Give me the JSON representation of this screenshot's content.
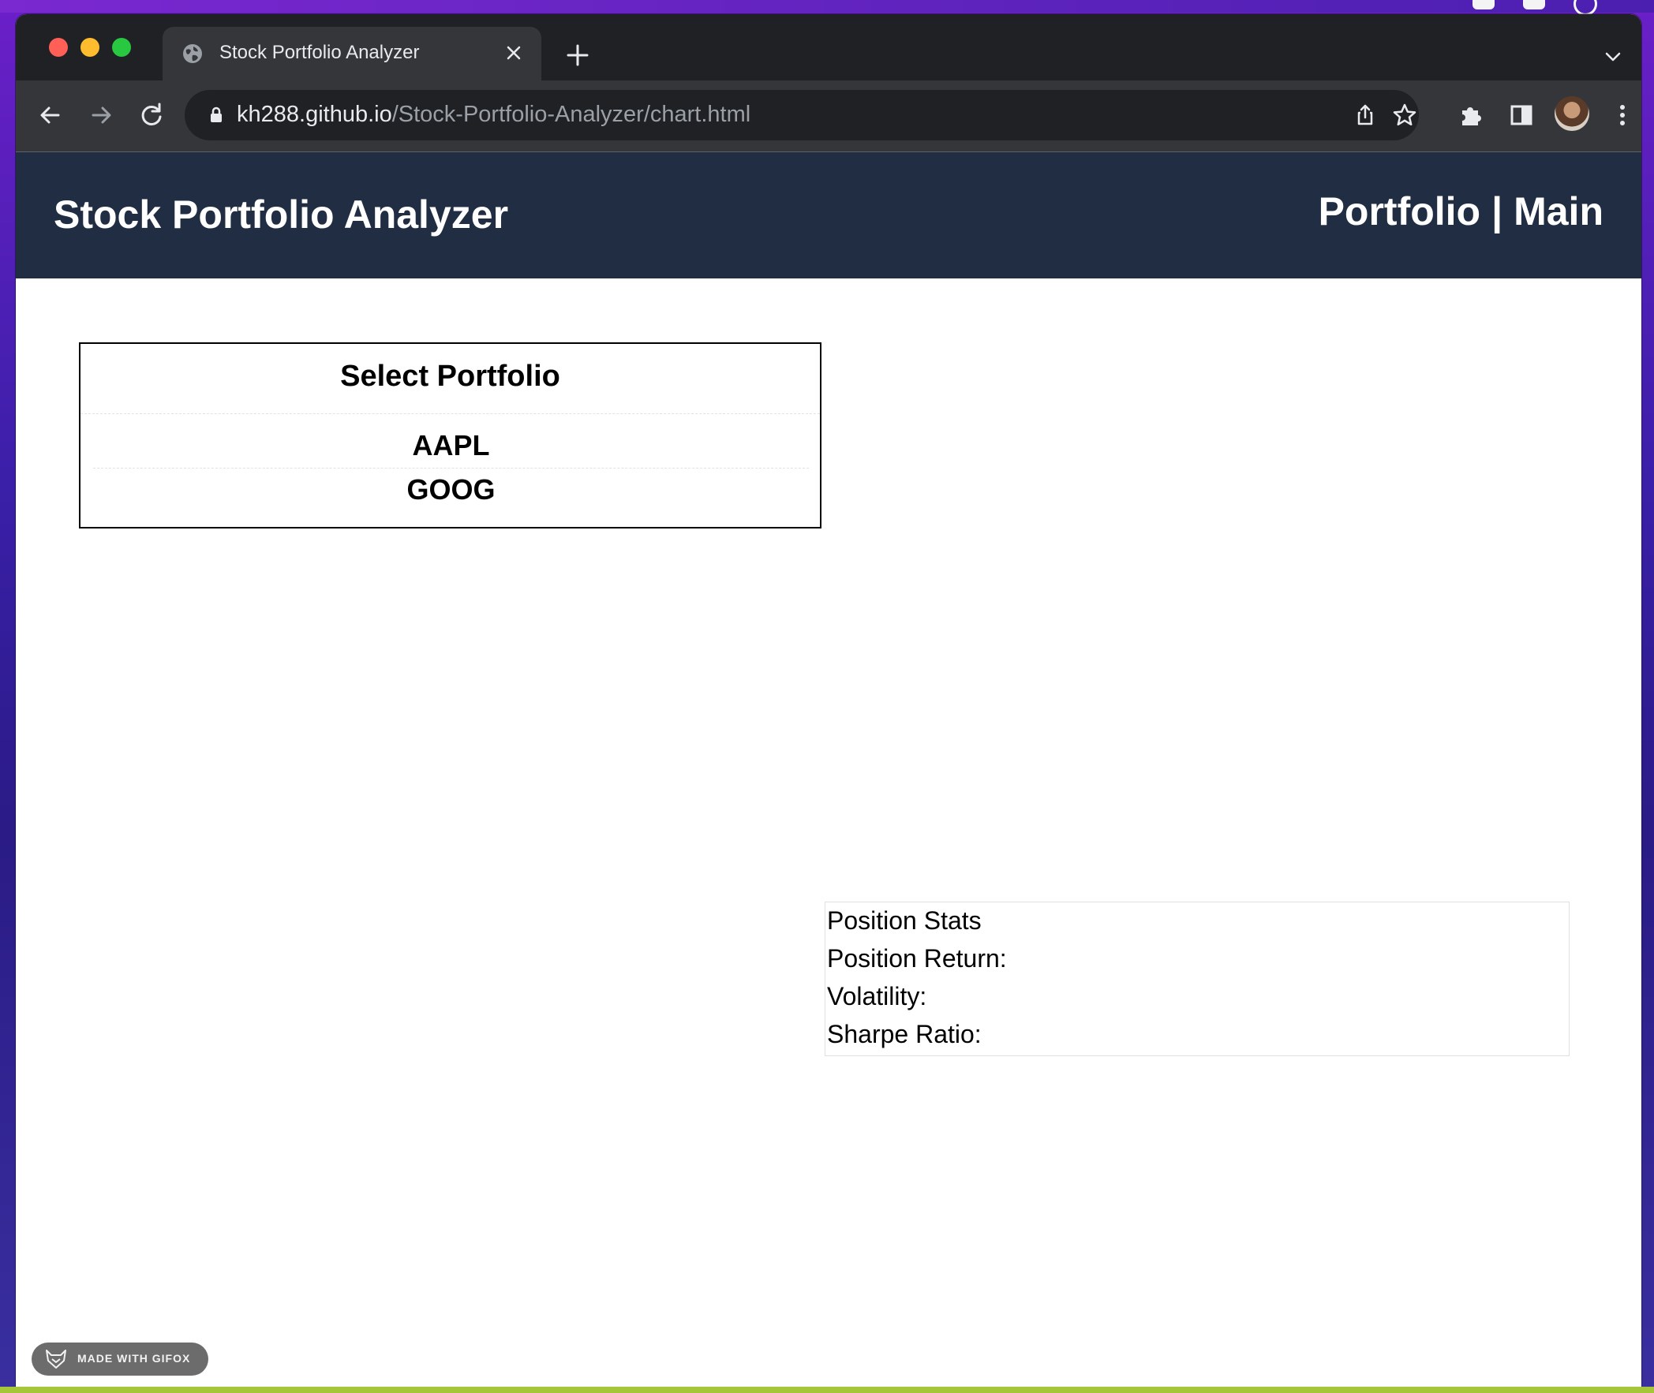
{
  "browser": {
    "tab_title": "Stock Portfolio Analyzer",
    "url_host": "kh288.github.io",
    "url_path": "/Stock-Portfolio-Analyzer/chart.html",
    "icons": [
      "globe-icon",
      "close-icon",
      "plus-icon",
      "chevron-down-icon",
      "back-arrow-icon",
      "forward-arrow-icon",
      "reload-icon",
      "lock-icon",
      "share-icon",
      "star-icon",
      "puzzle-icon",
      "side-panel-icon",
      "avatar",
      "kebab-menu-icon"
    ]
  },
  "header": {
    "title": "Stock Portfolio Analyzer",
    "nav_portfolio": "Portfolio",
    "nav_separator": "|",
    "nav_main": "Main",
    "background_color": "#212d42"
  },
  "selector": {
    "title": "Select Portfolio",
    "tickers": [
      "AAPL",
      "GOOG"
    ]
  },
  "stats": {
    "title": "Position Stats",
    "position_return_label": "Position Return:",
    "volatility_label": "Volatility:",
    "sharpe_ratio_label": "Sharpe Ratio:"
  },
  "watermark": {
    "label": "MADE WITH GIFOX"
  }
}
